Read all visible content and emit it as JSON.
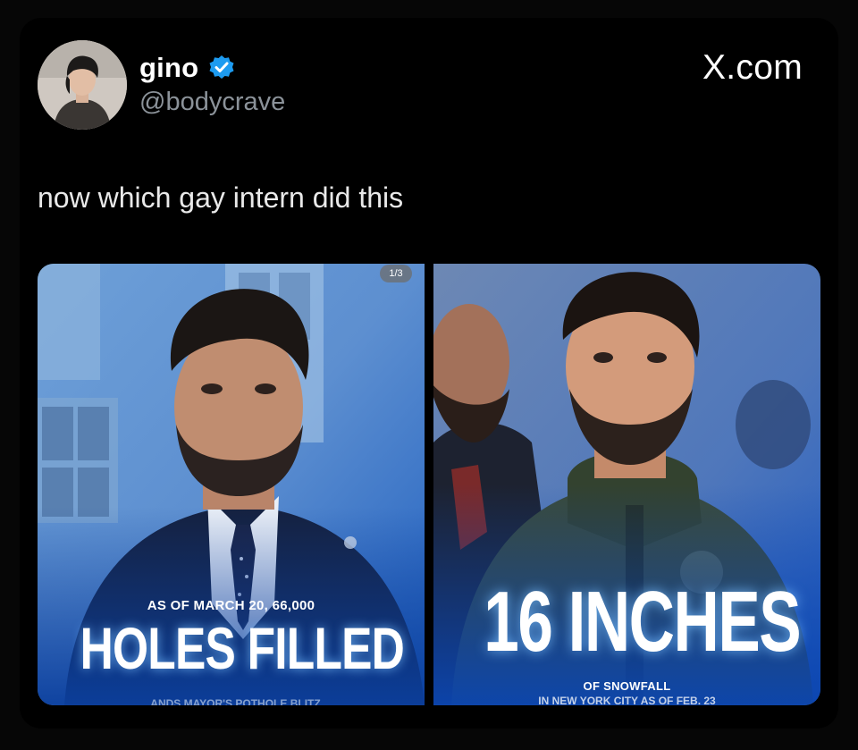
{
  "author": {
    "display_name": "gino",
    "handle": "@bodycrave",
    "verified": true
  },
  "site_label": "X.com",
  "tweet_text": "now which gay intern did this",
  "media": {
    "counter": "1/3",
    "left_image": {
      "caption_small": "AS OF MARCH 20, 66,000",
      "caption_big": "HOLES FILLED",
      "caption_tail": "...ANDS MAYOR'S POTHOLE BLITZ"
    },
    "right_image": {
      "caption_big": "16 INCHES",
      "caption_small": "OF SNOWFALL",
      "caption_tail": "IN NEW YORK CITY AS OF FEB. 23"
    }
  },
  "colors": {
    "background": "#000000",
    "text": "#ffffff",
    "handle": "#8b9299",
    "verified_badge": "#1d9bf0",
    "caption_glow": "#2f7bd9"
  }
}
